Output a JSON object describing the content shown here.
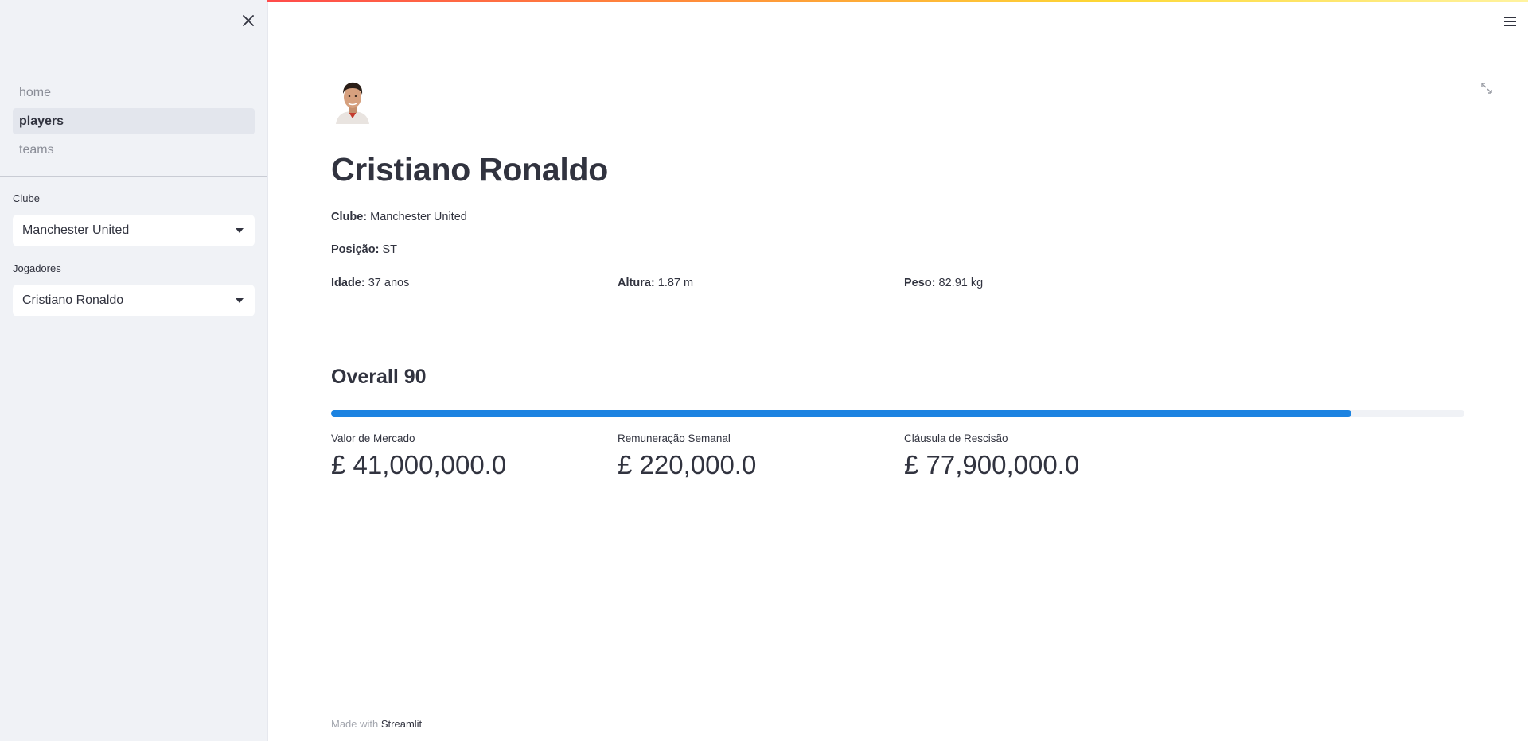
{
  "sidebar": {
    "nav": [
      {
        "label": "home",
        "active": false
      },
      {
        "label": "players",
        "active": true
      },
      {
        "label": "teams",
        "active": false
      }
    ],
    "club_filter": {
      "label": "Clube",
      "value": "Manchester United"
    },
    "player_filter": {
      "label": "Jogadores",
      "value": "Cristiano Ronaldo"
    }
  },
  "header": {
    "accent_gradient": [
      "#ff4b4b",
      "#ff8c3a",
      "#fdd835",
      "#fff3a0"
    ]
  },
  "player": {
    "name": "Cristiano Ronaldo",
    "club_label": "Clube:",
    "club_value": "Manchester United",
    "position_label": "Posição:",
    "position_value": "ST",
    "age_label": "Idade:",
    "age_value": "37 anos",
    "height_label": "Altura:",
    "height_value": "1.87 m",
    "weight_label": "Peso:",
    "weight_value": "82.91 kg"
  },
  "overall": {
    "title": "Overall 90",
    "progress": 0.9,
    "bar_color": "#1c83e1"
  },
  "metrics": [
    {
      "label": "Valor de Mercado",
      "value": "£ 41,000,000.0"
    },
    {
      "label": "Remuneração Semanal",
      "value": "£ 220,000.0"
    },
    {
      "label": "Cláusula de Rescisão",
      "value": "£ 77,900,000.0"
    }
  ],
  "footer": {
    "prefix": "Made with ",
    "brand": "Streamlit"
  }
}
